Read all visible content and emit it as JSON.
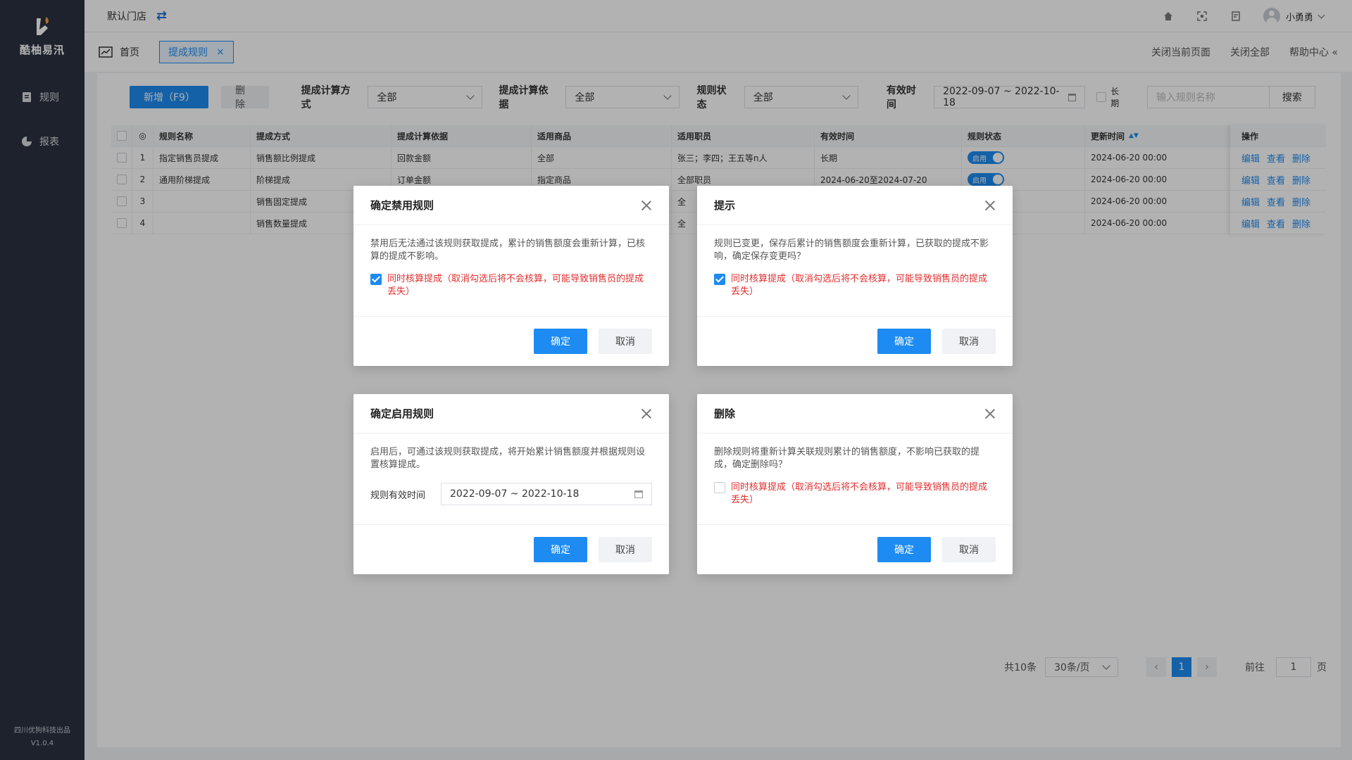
{
  "sidebar": {
    "logo_text": "酷柚易汛",
    "items": [
      {
        "label": "规则",
        "icon": "document-icon"
      },
      {
        "label": "报表",
        "icon": "pie-chart-icon"
      }
    ],
    "footer_company": "四川优狗科技出品",
    "footer_version": "V1.0.4"
  },
  "topbar": {
    "store_name": "默认门店",
    "user_name": "小勇勇"
  },
  "tabs": {
    "home_label": "首页",
    "active_label": "提成规则",
    "close_current": "关闭当前页面",
    "close_all": "关闭全部",
    "help_center": "帮助中心"
  },
  "filter": {
    "add_label": "新增（F9）",
    "delete_label": "删除",
    "calc_method_label": "提成计算方式",
    "calc_method_value": "全部",
    "calc_basis_label": "提成计算依据",
    "calc_basis_value": "全部",
    "status_label": "规则状态",
    "status_value": "全部",
    "valid_time_label": "有效时间",
    "valid_time_value": "2022-09-07 ~ 2022-10-18",
    "long_term_label": "长期",
    "search_placeholder": "输入规则名称",
    "search_label": "搜索"
  },
  "table": {
    "columns": [
      "规则名称",
      "提成方式",
      "提成计算依据",
      "适用商品",
      "适用职员",
      "有效时间",
      "规则状态",
      "更新时间"
    ],
    "op_header": "操作",
    "rows": [
      {
        "no": "1",
        "name": "指定销售员提成",
        "method": "销售额比例提成",
        "basis": "回款金额",
        "goods": "全部",
        "staff": "张三；李四；王五等n人",
        "time": "长期",
        "status": "启用",
        "updated": "2024-06-20 00:00"
      },
      {
        "no": "2",
        "name": "通用阶梯提成",
        "method": "阶梯提成",
        "basis": "订单金额",
        "goods": "指定商品",
        "staff": "全部职员",
        "time": "2024-06-20至2024-07-20",
        "status": "启用",
        "updated": "2024-06-20 00:00"
      },
      {
        "no": "3",
        "name": "",
        "method": "销售固定提成",
        "basis": "",
        "goods": "",
        "staff": "全",
        "time": "",
        "status": "",
        "updated": "2024-06-20 00:00"
      },
      {
        "no": "4",
        "name": "",
        "method": "销售数量提成",
        "basis": "",
        "goods": "",
        "staff": "全",
        "time": "",
        "status": "",
        "updated": "2024-06-20 00:00"
      }
    ],
    "ops": [
      "编辑",
      "查看",
      "删除"
    ]
  },
  "pager": {
    "total": "共10条",
    "page_size": "30条/页",
    "current": "1",
    "goto_label": "前往",
    "goto_value": "1",
    "page_unit": "页"
  },
  "dialogs": {
    "disable": {
      "title": "确定禁用规则",
      "text": "禁用后无法通过该规则获取提成，累计的销售额度会重新计算，已核算的提成不影响。",
      "check_text": "同时核算提成（取消勾选后将不会核算，可能导致销售员的提成丢失）",
      "ok": "确定",
      "cancel": "取消"
    },
    "tip": {
      "title": "提示",
      "text": "规则已变更，保存后累计的销售额度会重新计算，已获取的提成不影响，确定保存变更吗？",
      "check_text": "同时核算提成（取消勾选后将不会核算，可能导致销售员的提成丢失）",
      "ok": "确定",
      "cancel": "取消"
    },
    "enable": {
      "title": "确定启用规则",
      "text": "启用后，可通过该规则获取提成，将开始累计销售额度并根据规则设置核算提成。",
      "range_label": "规则有效时间",
      "range_value": "2022-09-07 ~ 2022-10-18",
      "ok": "确定",
      "cancel": "取消"
    },
    "delete": {
      "title": "删除",
      "text": "删除规则将重新计算关联规则累计的销售额度，不影响已获取的提成，确定删除吗？",
      "check_text": "同时核算提成（取消勾选后将不会核算，可能导致销售员的提成丢失）",
      "ok": "确定",
      "cancel": "取消"
    }
  },
  "colors": {
    "accent": "#1d8bf1",
    "sidebar_bg": "#2b3240",
    "warning_text": "#e03030"
  }
}
